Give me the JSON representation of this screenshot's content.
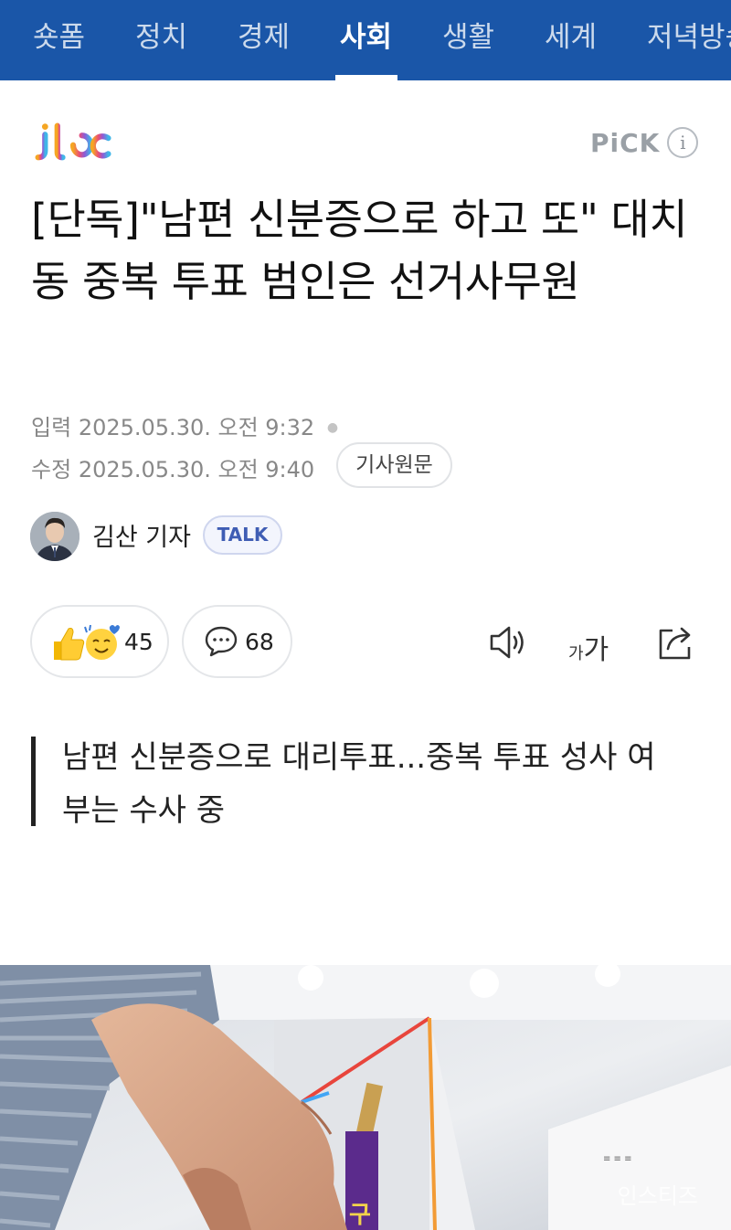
{
  "nav": {
    "tabs": [
      {
        "label": "숏폼"
      },
      {
        "label": "정치"
      },
      {
        "label": "경제"
      },
      {
        "label": "사회",
        "active": true
      },
      {
        "label": "생활"
      },
      {
        "label": "세계"
      },
      {
        "label": "저녁방송"
      }
    ],
    "bg_color": "#1a56a8"
  },
  "header": {
    "logo": "jtbc",
    "pick_label": "PiCK",
    "info_icon": "i"
  },
  "article": {
    "headline": "[단독]\"남편 신분증으로 하고 또\" 대치동 중복 투표 범인은 선거사무원",
    "published_label": "입력",
    "published": "2025.05.30. 오전 9:32",
    "modified_label": "수정",
    "modified": "2025.05.30. 오전 9:40",
    "original_link": "기사원문",
    "author": "김산 기자",
    "talk_label": "TALK",
    "reactions_count": "45",
    "comments_count": "68",
    "subheading": "남편 신분증으로 대리투표...중복 투표 성사 여부는 수사 중"
  },
  "toolbar": {
    "speaker_icon": "speaker-icon",
    "font_size_small": "가",
    "font_size_large": "가",
    "share_icon": "share-icon"
  },
  "photo": {
    "watermark": "인스티즈"
  }
}
